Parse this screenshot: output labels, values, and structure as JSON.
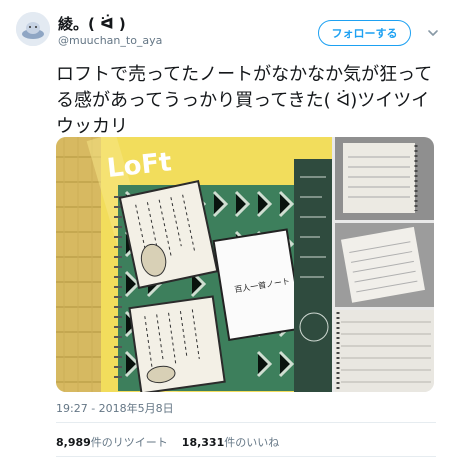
{
  "user": {
    "display_name": "綾。( ᐛ )",
    "handle": "@muuchan_to_aya"
  },
  "follow_button_label": "フォローする",
  "tweet": {
    "text": "ロフトで売ってたノートがなかなか気が狂ってる感があってうっかり買ってきた( ᐛ)ツイツイウッカリ"
  },
  "photos": {
    "brand_text": "LoFt",
    "notebook_label": "百人一首ノート"
  },
  "timestamp": "19:27 - 2018年5月8日",
  "stats": {
    "retweets_count": "8,989",
    "retweets_label": "件のリツイート",
    "likes_count": "18,331",
    "likes_label": "件のいいね"
  },
  "icons": {
    "chevron": "chevron-down-icon"
  },
  "colors": {
    "accent": "#1da1f2",
    "text": "#14171a",
    "muted": "#657786"
  }
}
